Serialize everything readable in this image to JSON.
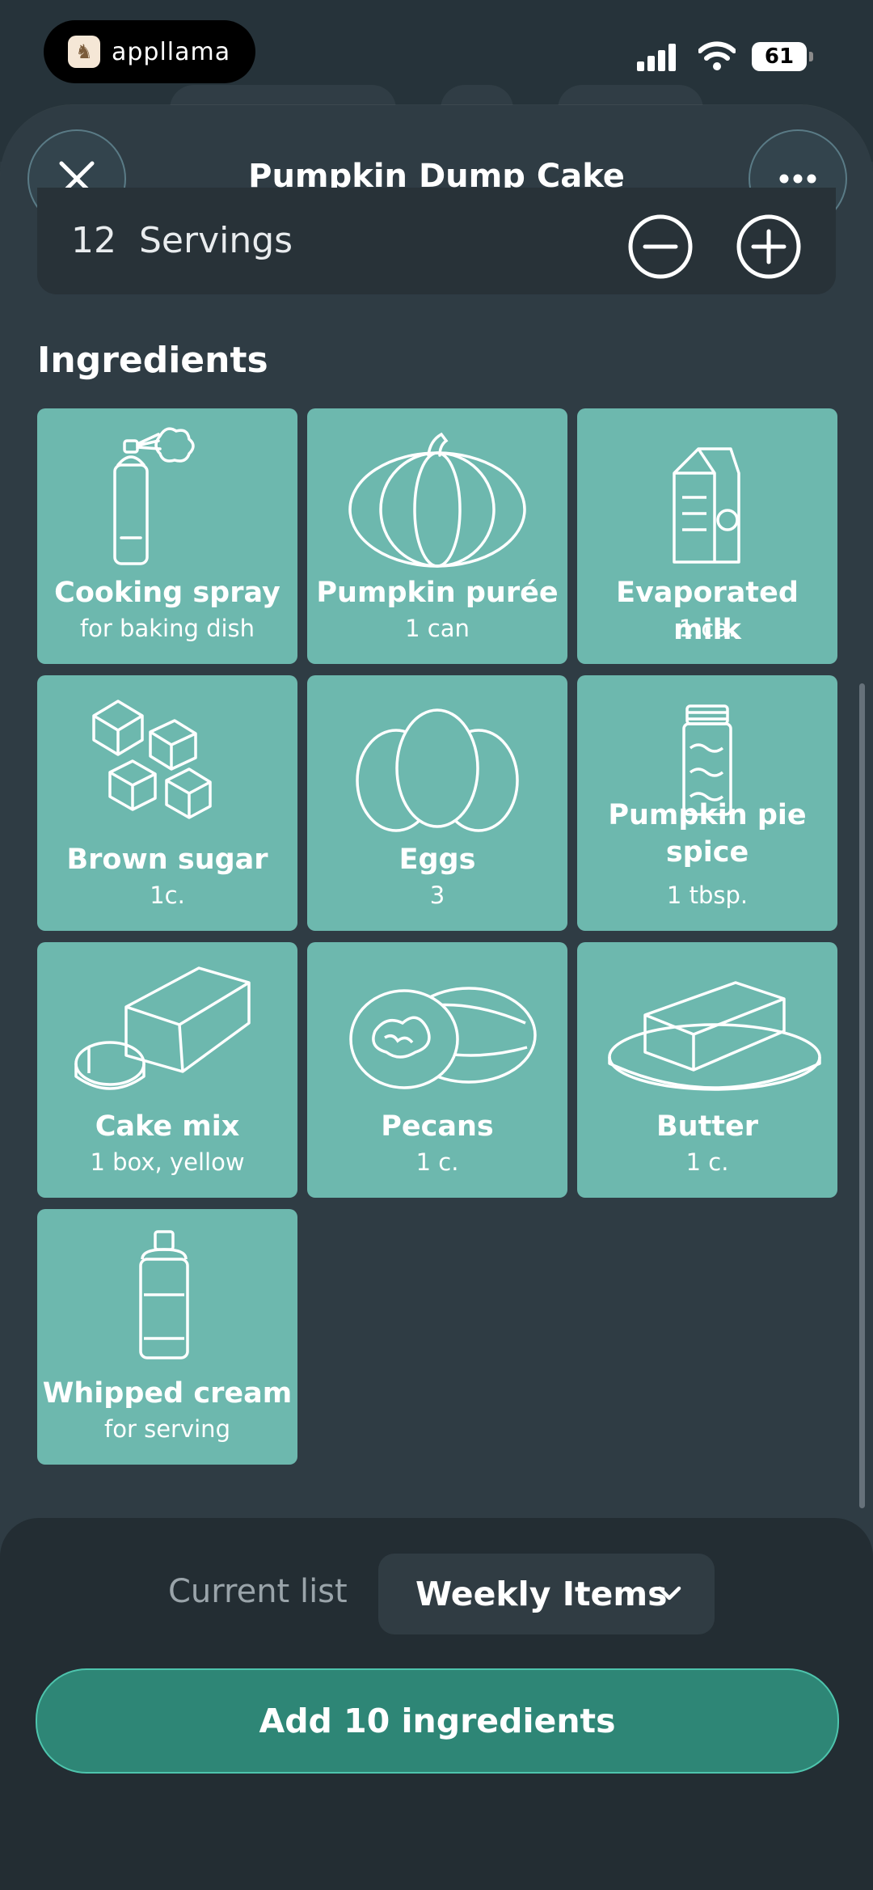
{
  "status_bar": {
    "app_name": "appllama",
    "battery": "61"
  },
  "header": {
    "title": "Pumpkin Dump Cake",
    "close_icon": "close-icon",
    "more_icon": "more-icon"
  },
  "servings": {
    "count": "12",
    "label": "Servings"
  },
  "ingredients": {
    "title": "Ingredients",
    "items": [
      {
        "name": "Cooking spray",
        "qty": "for baking dish",
        "icon": "spray-can-icon"
      },
      {
        "name": "Pumpkin purée",
        "qty": "1 can",
        "icon": "pumpkin-icon"
      },
      {
        "name": "Evaporated milk",
        "qty": "1 ca.",
        "icon": "milk-carton-icon"
      },
      {
        "name": "Brown sugar",
        "qty": "1c.",
        "icon": "sugar-cubes-icon"
      },
      {
        "name": "Eggs",
        "qty": "3",
        "icon": "eggs-icon"
      },
      {
        "name": "Pumpkin pie spice",
        "qty": "1 tbsp.",
        "icon": "spice-jar-icon"
      },
      {
        "name": "Cake mix",
        "qty": "1 box, yellow",
        "icon": "cake-loaf-icon"
      },
      {
        "name": "Pecans",
        "qty": "1 c.",
        "icon": "pecans-icon"
      },
      {
        "name": "Butter",
        "qty": "1 c.",
        "icon": "butter-icon"
      },
      {
        "name": "Whipped cream",
        "qty": "for serving",
        "icon": "whipped-cream-can-icon"
      }
    ]
  },
  "bottom": {
    "current_list_label": "Current list",
    "list_value": "Weekly Items",
    "add_button": "Add 10 ingredients"
  },
  "colors": {
    "tile": "#6db8ae",
    "accent": "#2e8676",
    "background": "#2f3c44"
  }
}
